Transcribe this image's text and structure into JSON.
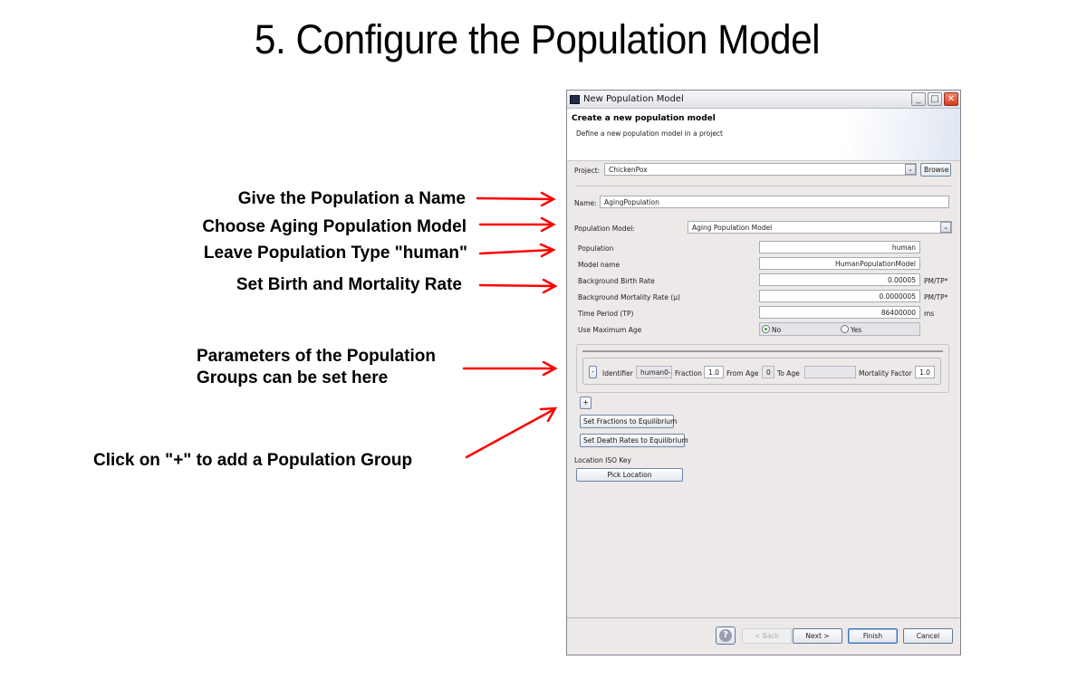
{
  "slide": {
    "title": "5. Configure the Population Model",
    "annotation_color": "#ff0000",
    "callouts": [
      {
        "text": "Give the Population a Name"
      },
      {
        "text": "Choose Aging Population Model"
      },
      {
        "text": "Leave Population Type \"human\""
      },
      {
        "text": "Set Birth and Mortality Rate"
      },
      {
        "text": "Parameters of the Population",
        "text2": "Groups can be set here"
      },
      {
        "text": "Click on \"+\" to add a Population Group"
      }
    ]
  },
  "window": {
    "title": "New Population Model",
    "controls": {
      "minimize": "_",
      "maximize": "□",
      "close": "✕"
    },
    "header_title": "Create a new population model",
    "header_subtitle": "Define a new population model in a project"
  },
  "form": {
    "project_label": "Project:",
    "project_value": "ChickenPox",
    "browse_label": "Browse",
    "name_label": "Name:",
    "name_value": "AgingPopulation",
    "model_label": "Population Model:",
    "model_value": "Aging Population Model",
    "params": [
      {
        "label": "Population",
        "value": "human",
        "unit": ""
      },
      {
        "label": "Model name",
        "value": "HumanPopulationModel",
        "unit": ""
      },
      {
        "label": "Background Birth Rate",
        "value": "0.00005",
        "unit": "PM/TP*"
      },
      {
        "label": "Background Mortality Rate (µ)",
        "value": "0.0000005",
        "unit": "PM/TP*"
      },
      {
        "label": "Time Period (TP)",
        "value": "86400000",
        "unit": "ms"
      }
    ],
    "max_age_label": "Use Maximum Age",
    "max_age_options": [
      {
        "label": "No",
        "selected": true
      },
      {
        "label": "Yes",
        "selected": false
      }
    ]
  },
  "group": {
    "remove_label": "-",
    "identifier_label": "Identifier",
    "identifier_value": "human0-",
    "fraction_label": "Fraction",
    "fraction_value": "1.0",
    "from_age_label": "From Age",
    "from_age_value": "0",
    "to_age_label": "To Age",
    "to_age_value": "",
    "mortality_label": "Mortality Factor",
    "mortality_value": "1.0"
  },
  "actions": {
    "add_label": "+",
    "set_fractions_label": "Set Fractions to Equilibrium",
    "set_death_rates_label": "Set Death Rates to Equilibrium",
    "location_label": "Location ISO Key",
    "pick_location_label": "Pick Location"
  },
  "footer": {
    "help_label": "?",
    "back_label": "< Back",
    "next_label": "Next >",
    "finish_label": "Finish",
    "cancel_label": "Cancel"
  }
}
